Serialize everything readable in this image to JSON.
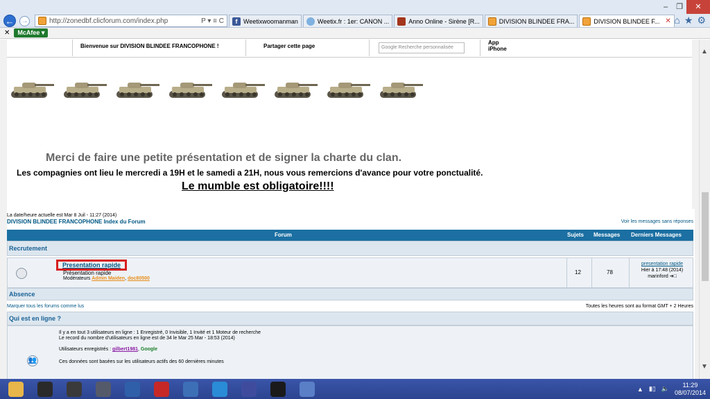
{
  "browser": {
    "url": "http://zonedbf.clicforum.com/index.php",
    "address_tools": "P ▾ ≡ C",
    "tabs": [
      {
        "label": "Weetixwoomanman",
        "icon": "facebook-icon",
        "active": false
      },
      {
        "label": "Weetix.fr : 1er: CANON ...",
        "icon": "weetix-icon",
        "active": false
      },
      {
        "label": "Anno Online - Sirène [R...",
        "icon": "anno-icon",
        "active": false
      },
      {
        "label": "DIVISION BLINDEE FRA...",
        "icon": "clicforum-icon",
        "active": false
      },
      {
        "label": "DIVISION BLINDEE F...",
        "icon": "clicforum-icon",
        "active": true
      }
    ],
    "window_controls": [
      "–",
      "❐",
      "✕"
    ],
    "command_icons": [
      "⌂",
      "★",
      "⚙"
    ],
    "toolbar": {
      "close": "✕",
      "mcafee": "McAfee"
    }
  },
  "site_topbar": {
    "welcome": "Bienvenue sur DIVISION BLINDEE FRANCOPHONE !",
    "share": "Partager cette page",
    "search_placeholder": "Recherche personnalisée",
    "search_google": "Google",
    "app": "App",
    "iphone": "iPhone"
  },
  "banner": {
    "tank_count": 8,
    "message_main": "Merci de faire une petite présentation et de signer la charte du clan.",
    "message_schedule": "Les compagnies ont lieu le mercredi a 19H et le samedi a 21H, nous vous remercions d'avance pour votre ponctualité.",
    "message_mumble": "Le mumble est obligatoire!!!!"
  },
  "forum": {
    "datetime": "La date/heure actuelle est Mar 8 Juil - 11:27 (2014)",
    "index_link": "DIVISION BLINDEE FRANCOPHONE Index du Forum",
    "unanswered": "Voir les messages sans réponses",
    "headers": {
      "forum": "Forum",
      "topics": "Sujets",
      "posts": "Messages",
      "last": "Derniers Messages"
    },
    "category_recrutement": "Recrutement",
    "category_absence": "Absence",
    "row": {
      "title": "Presentation rapide",
      "description": "Présentation rapide",
      "moderators_label": "Modérateurs",
      "moderator1": "Admin Maiden",
      "moderator2": "doc80500",
      "topics": "12",
      "posts": "78",
      "last_title": "presentation rapide",
      "last_date": "Hier à 17:48 (2014)",
      "last_author": "marinford"
    },
    "mark_read": "Marquer tous les forums comme lus",
    "timezone": "Toutes les heures sont au format GMT + 2 Heures",
    "online_title": "Qui est en ligne ?",
    "online_line1": "Il y a en tout 3 utilisateurs en ligne : 1 Enregistré, 0 Invisible, 1 Invité et 1 Moteur de recherche",
    "online_line2": "Le record du nombre d'utilisateurs en ligne est de 34 le Mar 25 Mar - 18:53 (2014)",
    "online_registered_label": "Utilisateurs enregistrés :",
    "online_user": "gilbert1981",
    "online_bot": "Google",
    "online_note": "Ces données sont basées sur les utilisateurs actifs des 60 dernières minutes"
  },
  "taskbar": {
    "time": "11:29",
    "date": "08/07/2014",
    "apps": [
      "file-explorer-icon",
      "media-player-icon",
      "speaker-icon",
      "calculator-icon",
      "app-icon",
      "power-icon",
      "image-viewer-icon",
      "internet-explorer-icon",
      "video-icon",
      "skype-icon",
      "paint-icon"
    ],
    "app_colors": [
      "#e8b64a",
      "#2a2a2a",
      "#3a3a3a",
      "#555a6a",
      "#2f5fa8",
      "#c62828",
      "#3d6fb7",
      "#2a8cd6",
      "#3f4c9e",
      "#1a1a1a",
      "#5a7fc7"
    ]
  }
}
